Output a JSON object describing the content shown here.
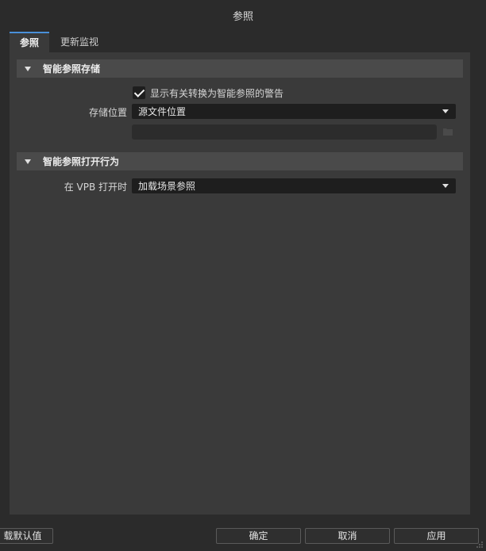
{
  "window": {
    "title": "参照"
  },
  "tabs": [
    {
      "label": "参照",
      "active": true
    },
    {
      "label": "更新监视",
      "active": false
    }
  ],
  "sections": {
    "storage": {
      "header": "智能参照存储",
      "warning_checkbox": {
        "label": "显示有关转换为智能参照的警告",
        "checked": true
      },
      "location_label": "存储位置",
      "location_value": "源文件位置",
      "path_value": ""
    },
    "open_behavior": {
      "header": "智能参照打开行为",
      "on_open_label": "在 VPB 打开时",
      "on_open_value": "加载场景参照"
    }
  },
  "footer": {
    "reset_label": "载默认值",
    "ok_label": "确定",
    "cancel_label": "取消",
    "apply_label": "应用"
  },
  "colors": {
    "background": "#2b2b2b",
    "panel": "#3a3a3a",
    "section_header": "#4a4a4a",
    "field": "#1e1e1e",
    "active_tab_accent": "#4a90d9"
  },
  "icons": [
    "checkmark-icon",
    "folder-icon",
    "chevron-down-icon",
    "collapse-triangle-icon",
    "resize-grip-icon"
  ]
}
